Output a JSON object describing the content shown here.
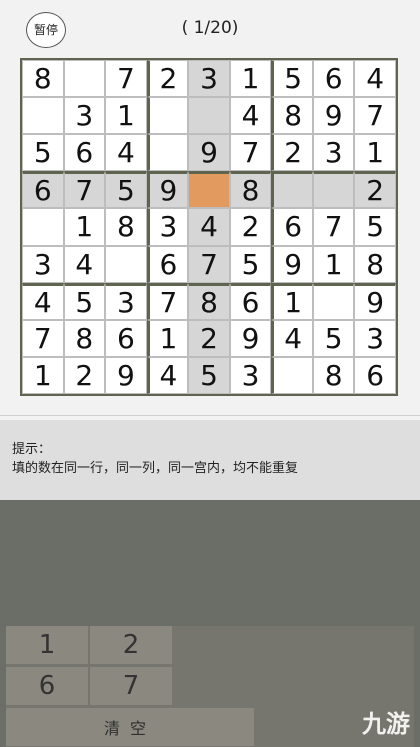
{
  "header": {
    "pause_label": "暂停",
    "progress": "( 1/20)"
  },
  "board": {
    "rows": [
      [
        "8",
        "",
        "7",
        "2",
        "3",
        "1",
        "5",
        "6",
        "4"
      ],
      [
        "",
        "3",
        "1",
        "",
        "",
        "4",
        "8",
        "9",
        "7"
      ],
      [
        "5",
        "6",
        "4",
        "",
        "9",
        "7",
        "2",
        "3",
        "1"
      ],
      [
        "6",
        "7",
        "5",
        "9",
        "",
        "8",
        "",
        "",
        "2"
      ],
      [
        "",
        "1",
        "8",
        "3",
        "4",
        "2",
        "6",
        "7",
        "5"
      ],
      [
        "3",
        "4",
        "",
        "6",
        "7",
        "5",
        "9",
        "1",
        "8"
      ],
      [
        "4",
        "5",
        "3",
        "7",
        "8",
        "6",
        "1",
        "",
        "9"
      ],
      [
        "7",
        "8",
        "6",
        "1",
        "2",
        "9",
        "4",
        "5",
        "3"
      ],
      [
        "1",
        "2",
        "9",
        "4",
        "5",
        "3",
        "",
        "8",
        "6"
      ]
    ],
    "selected": {
      "row": 3,
      "col": 4
    },
    "colors": {
      "selected": "#e39a5e",
      "highlight": "#d6d6d6"
    }
  },
  "hint": {
    "title": "提示：",
    "text": "填的数在同一行，同一列，同一宫内，均不能重复"
  },
  "keypad": {
    "keys": [
      "1",
      "2",
      "6",
      "7"
    ],
    "clear_label": "清空"
  },
  "watermark": "九游"
}
